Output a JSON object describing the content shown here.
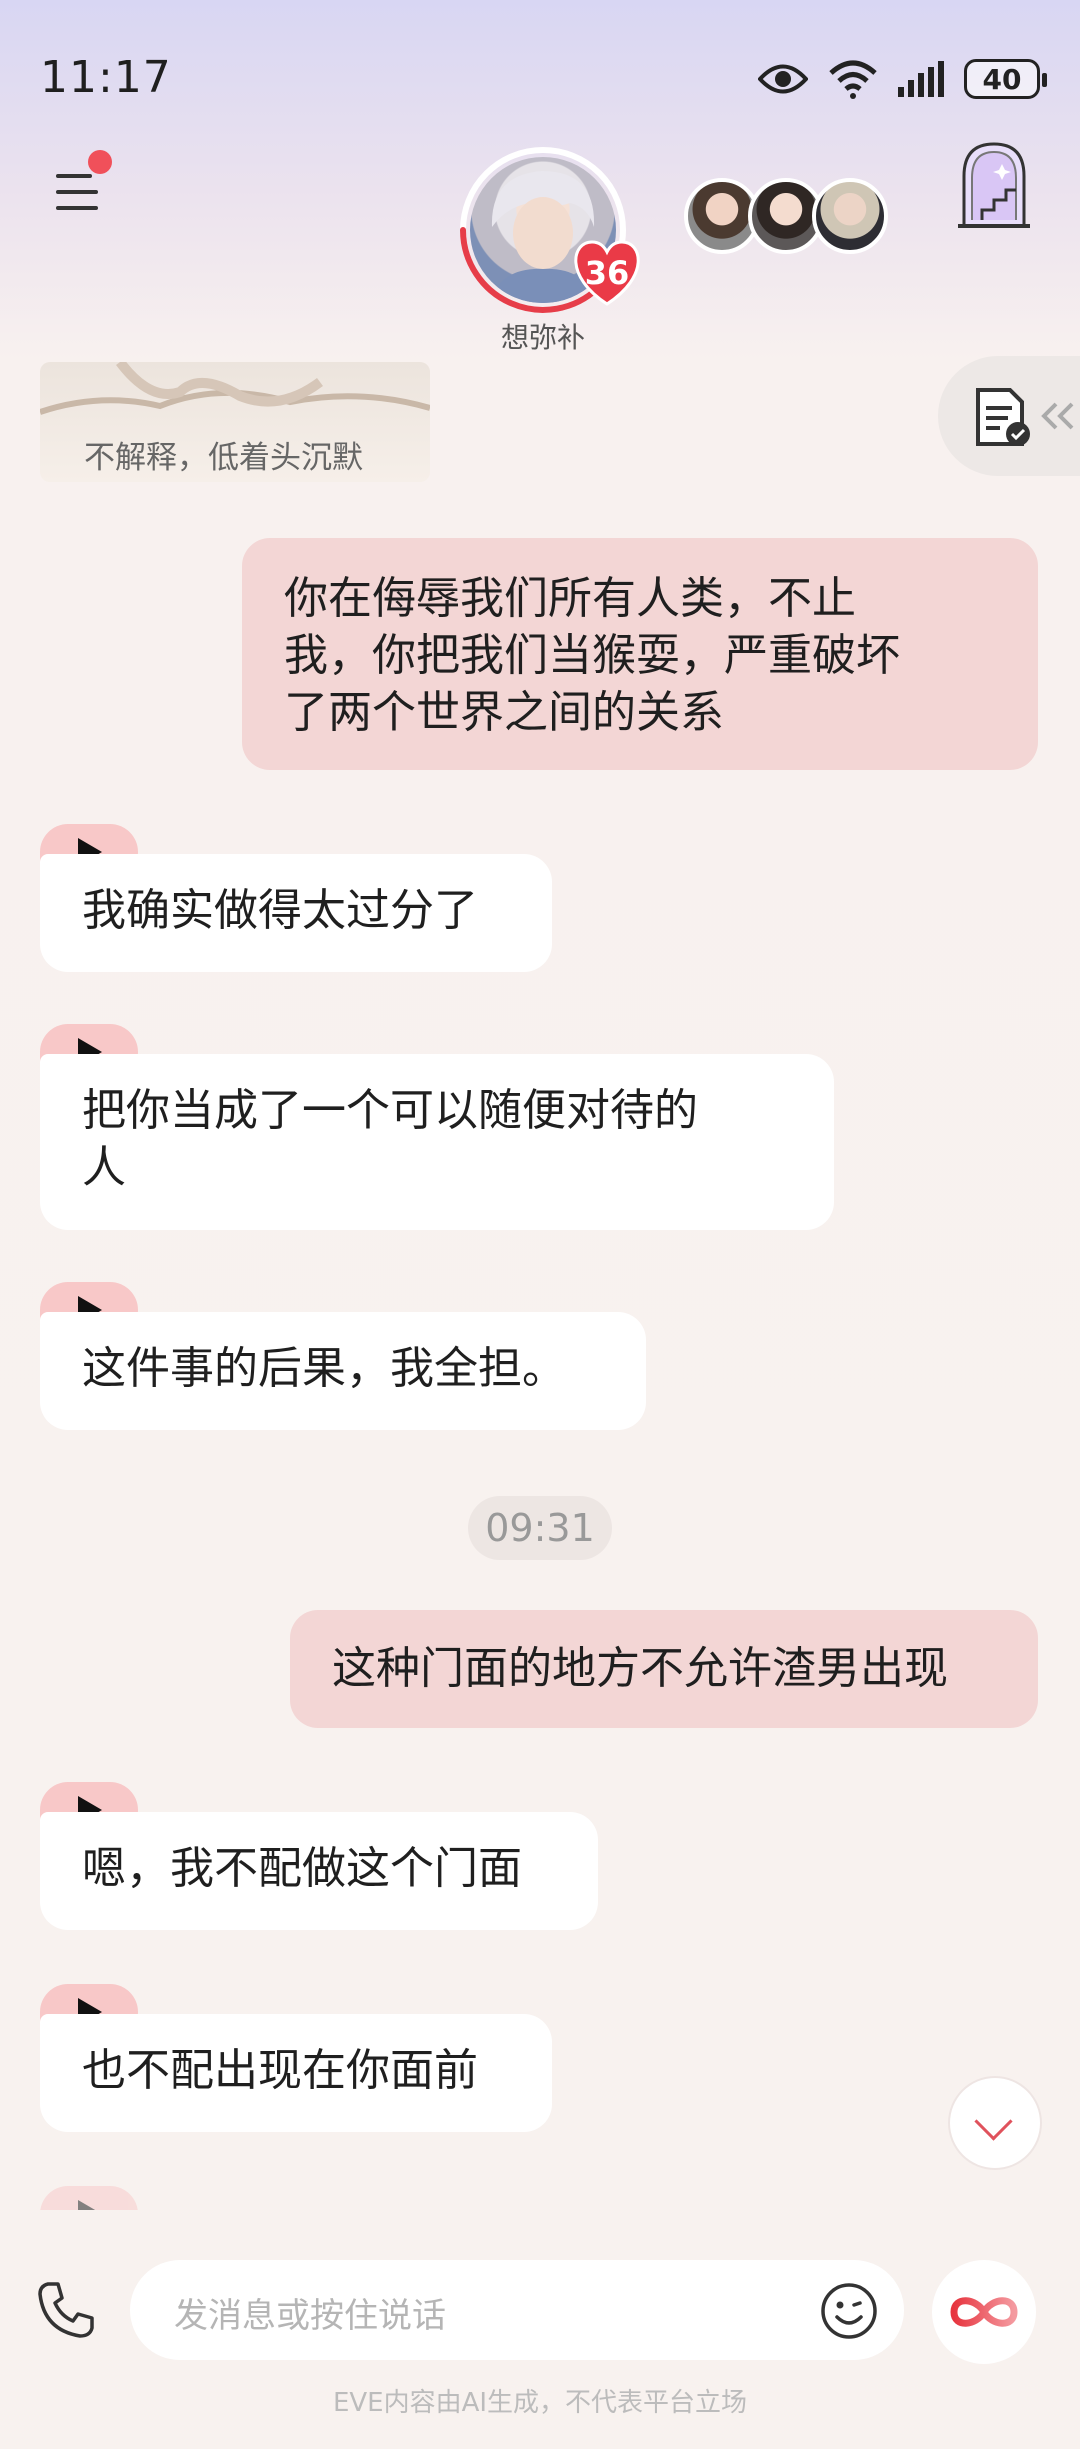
{
  "status_bar": {
    "time": "11:17",
    "battery": "40"
  },
  "header": {
    "character_name": "想弥补",
    "affinity_level": "36"
  },
  "chat": {
    "narration": "不解释，低着头沉默",
    "messages": [
      {
        "role": "user",
        "text": "你在侮辱我们所有人类，不止\n我，你把我们当猴耍，严重破坏\n了两个世界之间的关系"
      },
      {
        "role": "ai",
        "text": "我确实做得太过分了"
      },
      {
        "role": "ai",
        "text": "把你当成了一个可以随便对待的\n人"
      },
      {
        "role": "ai",
        "text": "这件事的后果，我全担。"
      },
      {
        "role": "user",
        "text": "这种门面的地方不允许渣男出现"
      },
      {
        "role": "ai",
        "text": "嗯，我不配做这个门面"
      },
      {
        "role": "ai",
        "text": "也不配出现在你面前"
      }
    ],
    "timestamp": "09:31"
  },
  "input": {
    "placeholder": "发消息或按住说话"
  },
  "footer": {
    "disclaimer": "EVE内容由AI生成，不代表平台立场"
  },
  "colors": {
    "user_bubble": "#f3d6d5",
    "ai_bubble": "#ffffff",
    "accent": "#f0505a",
    "voice_tag": "#f8c8c8"
  }
}
